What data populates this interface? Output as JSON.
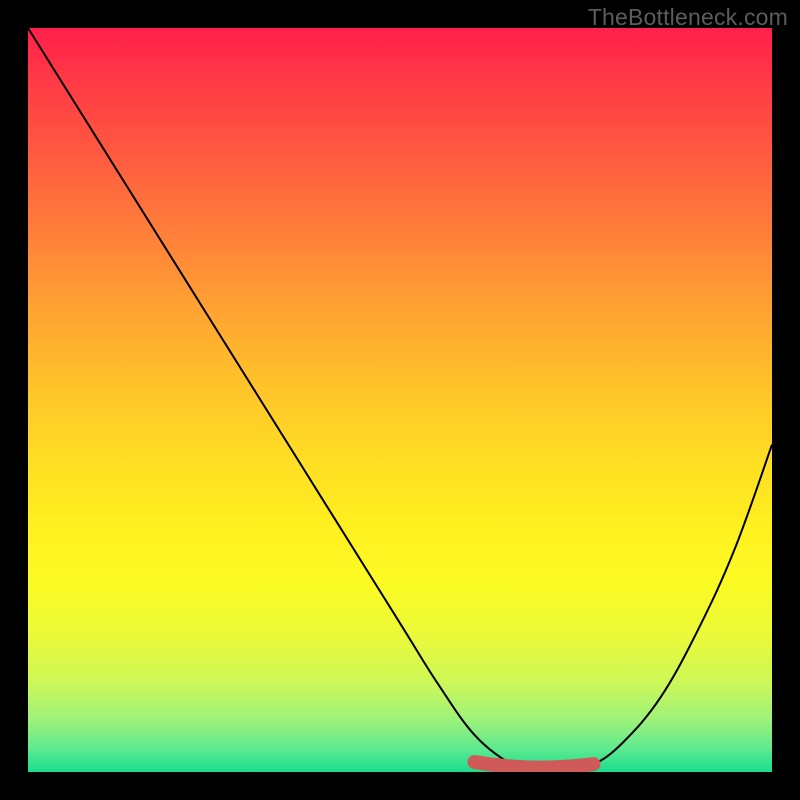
{
  "watermark": "TheBottleneck.com",
  "chart_data": {
    "type": "line",
    "title": "",
    "xlabel": "",
    "ylabel": "",
    "xlim": [
      0,
      100
    ],
    "ylim": [
      0,
      100
    ],
    "grid": false,
    "series": [
      {
        "name": "curve",
        "x": [
          0,
          10,
          20,
          30,
          40,
          50,
          55,
          60,
          65,
          68,
          72,
          76,
          80,
          85,
          90,
          95,
          100
        ],
        "y": [
          100,
          84,
          68,
          52,
          36,
          20,
          12,
          5,
          1,
          0,
          0,
          1,
          4,
          10,
          19,
          30,
          44
        ]
      },
      {
        "name": "emphasis-band",
        "x": [
          60,
          76
        ],
        "y": [
          0.8,
          0.8
        ]
      }
    ],
    "gradient_stops": [
      {
        "pos": 0.0,
        "color": "#ff1f4b"
      },
      {
        "pos": 0.5,
        "color": "#ffdb24"
      },
      {
        "pos": 1.0,
        "color": "#17de8f"
      }
    ]
  }
}
